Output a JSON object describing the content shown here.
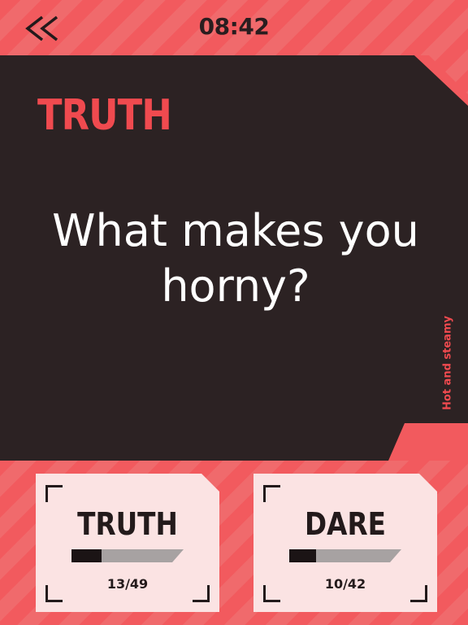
{
  "header": {
    "clock": "08:42",
    "back_icon": "double-chevron-left-icon"
  },
  "card": {
    "mode": "TRUTH",
    "question": "What makes you horny?",
    "category": "Hot and steamy"
  },
  "choices": [
    {
      "label": "TRUTH",
      "count": "13/49",
      "progress": 0.27
    },
    {
      "label": "DARE",
      "count": "10/42",
      "progress": 0.24
    }
  ],
  "colors": {
    "accent": "#f04a4f",
    "card_bg": "#2c2223",
    "tile_bg": "#fbe3e3",
    "ink": "#231a1b"
  }
}
